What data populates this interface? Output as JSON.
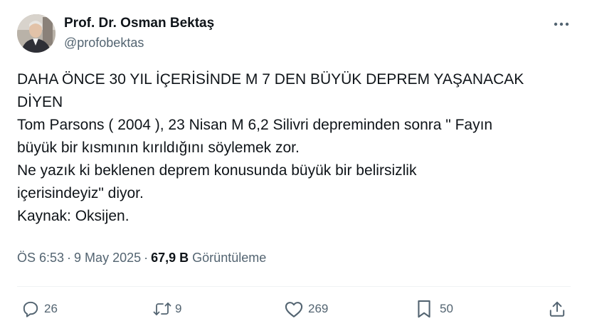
{
  "author": {
    "name": "Prof. Dr. Osman Bektaş",
    "handle": "@profobektas"
  },
  "tweet": {
    "lines": [
      "DAHA ÖNCE 30 YIL İÇERİSİNDE M 7 DEN BÜYÜK DEPREM YAŞANACAK",
      "DİYEN",
      "Tom Parsons ( 2004 ), 23 Nisan M 6,2 Silivri depreminden sonra \" Fayın",
      "büyük bir kısmının kırıldığını söylemek zor.",
      "Ne yazık ki beklenen deprem konusunda büyük bir belirsizlik",
      "içerisindeyiz\" diyor.",
      "Kaynak: Oksijen."
    ]
  },
  "meta": {
    "time": "ÖS 6:53",
    "separator": "·",
    "date": "9 May 2025",
    "views_count": "67,9 B",
    "views_label": "Görüntüleme"
  },
  "actions": {
    "replies": "26",
    "reposts": "9",
    "likes": "269",
    "bookmarks": "50"
  },
  "colors": {
    "text": "#0f1419",
    "secondary": "#536471",
    "divider": "#eff3f4"
  },
  "icons": [
    "more-icon",
    "reply-icon",
    "repost-icon",
    "like-icon",
    "bookmark-icon",
    "share-icon"
  ]
}
